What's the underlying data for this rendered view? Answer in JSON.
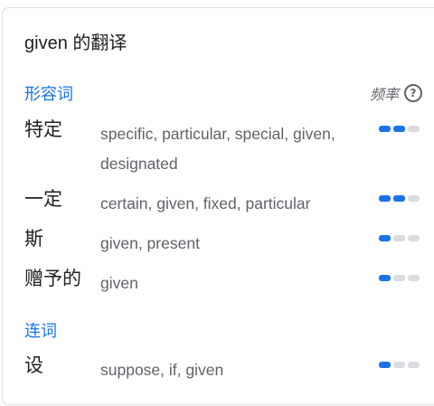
{
  "card": {
    "title": "given 的翻译",
    "frequency_label": "频率"
  },
  "colors": {
    "accent": "#1a73e8",
    "bar_inactive": "#dadce0",
    "text_primary": "#202124",
    "text_secondary": "#5f6368"
  },
  "icons": {
    "help": "help-circle-icon"
  },
  "sections": [
    {
      "label": "形容词",
      "entries": [
        {
          "term": "特定",
          "translations": "specific, particular, special, given, designated",
          "frequency": 2
        },
        {
          "term": "一定",
          "translations": "certain, given, fixed, particular",
          "frequency": 2
        },
        {
          "term": "斯",
          "translations": "given, present",
          "frequency": 1
        },
        {
          "term": "赠予的",
          "translations": "given",
          "frequency": 1
        }
      ]
    },
    {
      "label": "连词",
      "entries": [
        {
          "term": "设",
          "translations": "suppose, if, given",
          "frequency": 1
        }
      ]
    }
  ],
  "frequency_max": 3
}
